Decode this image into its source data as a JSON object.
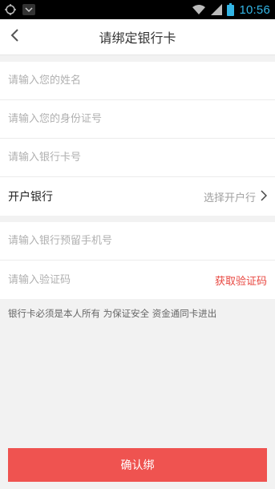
{
  "status_bar": {
    "time": "10:56",
    "icons": [
      "circle-icon",
      "chevron-down-icon",
      "wifi-icon",
      "signal-icon",
      "battery-icon"
    ]
  },
  "nav": {
    "title": "请绑定银行卡",
    "back_icon": "chevron-left-icon"
  },
  "form": {
    "name_placeholder": "请输入您的姓名",
    "id_placeholder": "请输入您的身份证号",
    "card_placeholder": "请输入银行卡号",
    "bank_label": "开户银行",
    "bank_select_text": "选择开户行",
    "phone_placeholder": "请输入银行预留手机号",
    "code_placeholder": "请输入验证码",
    "get_code_label": "获取验证码"
  },
  "notice": "银行卡必须是本人所有 为保证安全 资金通同卡进出",
  "confirm_label": "确认绑",
  "colors": {
    "accent": "#ef5350",
    "link": "#e8463f",
    "status_time": "#33b5e5"
  }
}
